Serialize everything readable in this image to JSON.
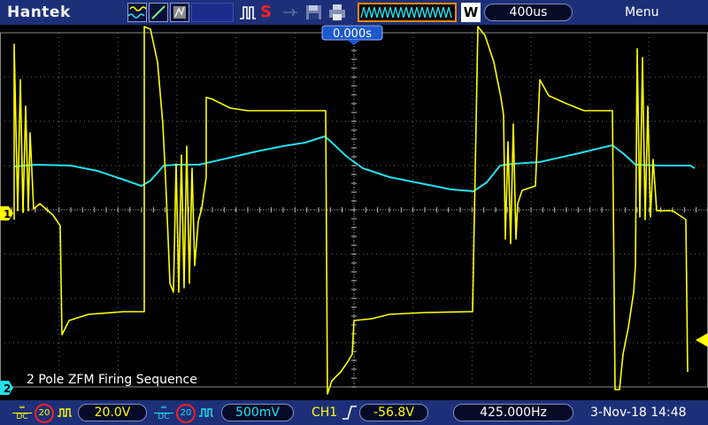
{
  "brand": "Hantek",
  "toolbar": {
    "trigger_mode_label": "W",
    "timebase": "400us",
    "menu_label": "Menu",
    "trigger_position": "0.000s"
  },
  "channels": {
    "ch1": {
      "marker": "1",
      "coupling": "DC",
      "bw_limit": "20",
      "volts_per_div": "20.0V",
      "color": "#ffff00"
    },
    "ch2": {
      "marker": "2",
      "coupling": "DC",
      "bw_limit": "20",
      "volts_per_div": "500mV",
      "color": "#22e0ee"
    }
  },
  "trigger": {
    "source": "CH1",
    "level": "-56.8V"
  },
  "frequency": "425.000Hz",
  "datetime": "3-Nov-18 14:48",
  "annotation": "2 Pole ZFM Firing Sequence"
}
